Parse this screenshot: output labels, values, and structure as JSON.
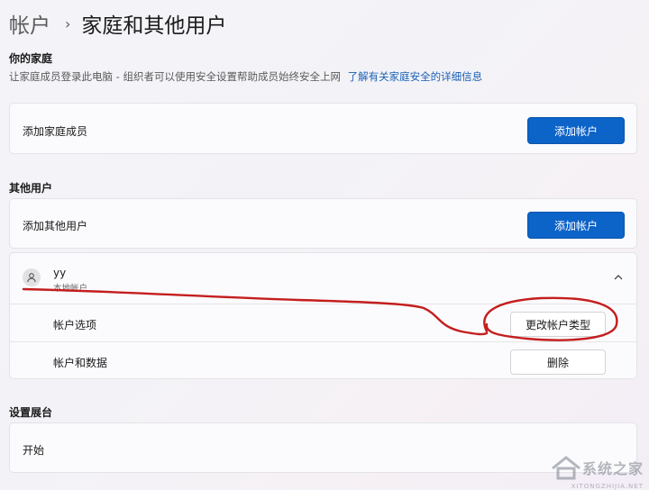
{
  "breadcrumb": {
    "parent": "帐户",
    "separator": "›",
    "current": "家庭和其他用户"
  },
  "family": {
    "section_title": "你的家庭",
    "description": "让家庭成员登录此电脑 - 组织者可以使用安全设置帮助成员始终安全上网",
    "learn_more_link": "了解有关家庭安全的详细信息",
    "add_member_label": "添加家庭成员",
    "add_member_button": "添加帐户"
  },
  "other_users": {
    "section_title": "其他用户",
    "add_other_label": "添加其他用户",
    "add_other_button": "添加帐户",
    "user": {
      "name": "yy",
      "type": "本地帐户",
      "icon": "person-icon",
      "expand_icon": "chevron-up-icon",
      "options_label": "帐户选项",
      "change_type_button": "更改帐户类型",
      "data_label": "帐户和数据",
      "delete_button": "删除"
    }
  },
  "kiosk": {
    "section_title": "设置展台",
    "start_label": "开始"
  },
  "watermark": {
    "text": "系统之家",
    "sub": "XITONGZHIJIA.NET"
  },
  "colors": {
    "accent": "#0c63c8",
    "link": "#1a5fb4",
    "annotation": "#c41e1e"
  }
}
